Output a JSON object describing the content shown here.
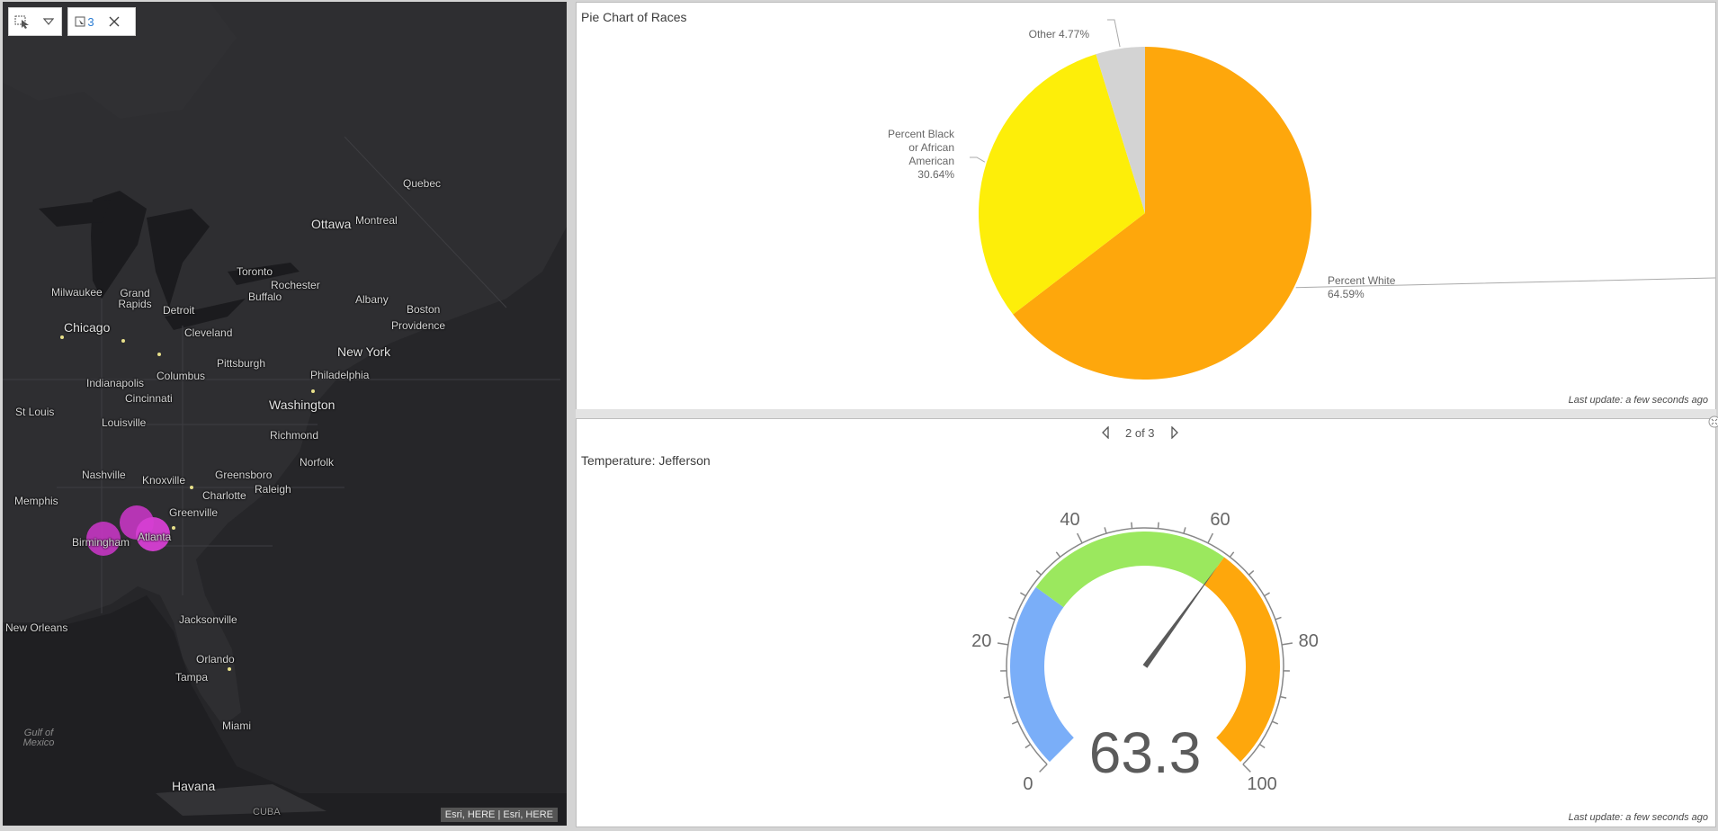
{
  "map": {
    "toolbar": {
      "selection_count": "3"
    },
    "labels": [
      {
        "text": "Quebec",
        "cls": ""
      },
      {
        "text": "Ottawa",
        "cls": "big"
      },
      {
        "text": "Montreal",
        "cls": ""
      },
      {
        "text": "Toronto",
        "cls": ""
      },
      {
        "text": "Rochester",
        "cls": ""
      },
      {
        "text": "Buffalo",
        "cls": ""
      },
      {
        "text": "Albany",
        "cls": ""
      },
      {
        "text": "Boston",
        "cls": ""
      },
      {
        "text": "Providence",
        "cls": ""
      },
      {
        "text": "Milwaukee",
        "cls": ""
      },
      {
        "text": "Grand Rapids",
        "cls": ""
      },
      {
        "text": "Detroit",
        "cls": ""
      },
      {
        "text": "Chicago",
        "cls": "big"
      },
      {
        "text": "Cleveland",
        "cls": ""
      },
      {
        "text": "New York",
        "cls": "big"
      },
      {
        "text": "Pittsburgh",
        "cls": ""
      },
      {
        "text": "Philadelphia",
        "cls": ""
      },
      {
        "text": "Indianapolis",
        "cls": ""
      },
      {
        "text": "Columbus",
        "cls": ""
      },
      {
        "text": "Cincinnati",
        "cls": ""
      },
      {
        "text": "Washington",
        "cls": "big"
      },
      {
        "text": "St Louis",
        "cls": ""
      },
      {
        "text": "Louisville",
        "cls": ""
      },
      {
        "text": "Richmond",
        "cls": ""
      },
      {
        "text": "Norfolk",
        "cls": ""
      },
      {
        "text": "Nashville",
        "cls": ""
      },
      {
        "text": "Knoxville",
        "cls": ""
      },
      {
        "text": "Greensboro",
        "cls": ""
      },
      {
        "text": "Raleigh",
        "cls": ""
      },
      {
        "text": "Charlotte",
        "cls": ""
      },
      {
        "text": "Memphis",
        "cls": ""
      },
      {
        "text": "Greenville",
        "cls": ""
      },
      {
        "text": "Atlanta",
        "cls": ""
      },
      {
        "text": "Birmingham",
        "cls": ""
      },
      {
        "text": "Jacksonville",
        "cls": ""
      },
      {
        "text": "New Orleans",
        "cls": ""
      },
      {
        "text": "Orlando",
        "cls": ""
      },
      {
        "text": "Tampa",
        "cls": ""
      },
      {
        "text": "Miami",
        "cls": ""
      },
      {
        "text": "Gulf of Mexico",
        "cls": "water"
      },
      {
        "text": "Havana",
        "cls": "big"
      },
      {
        "text": "CUBA",
        "cls": "country"
      }
    ],
    "attribution": "Esri, HERE | Esri, HERE",
    "highlight_color": "#d63fd3"
  },
  "pie_panel": {
    "title": "Pie Chart of Races",
    "last_update": "Last update: a few seconds ago"
  },
  "gauge_panel": {
    "pager": "2 of 3",
    "title": "Temperature: Jefferson",
    "last_update": "Last update: a few seconds ago"
  },
  "chart_data": [
    {
      "type": "pie",
      "title": "Pie Chart of Races",
      "slices": [
        {
          "name": "Percent White",
          "value": 64.59,
          "label_lines": [
            "Percent White",
            "64.59%"
          ],
          "color": "#fea70c"
        },
        {
          "name": "Percent Black or African American",
          "value": 30.64,
          "label_lines": [
            "Percent Black",
            "or African",
            "American",
            "30.64%"
          ],
          "color": "#fdee09"
        },
        {
          "name": "Other",
          "value": 4.77,
          "label_lines": [
            "Other 4.77%"
          ],
          "color": "#d3d3d3"
        }
      ]
    },
    {
      "type": "gauge",
      "title": "Temperature: Jefferson",
      "min": 0,
      "max": 100,
      "value": 63.3,
      "value_label": "63.3",
      "tick_labels": [
        "0",
        "20",
        "40",
        "60",
        "80",
        "100"
      ],
      "bands": [
        {
          "from": 0,
          "to": 30,
          "color": "#7aaef8"
        },
        {
          "from": 30,
          "to": 63.3,
          "color": "#9be85e"
        },
        {
          "from": 63.3,
          "to": 100,
          "color": "#fea70c"
        }
      ]
    }
  ]
}
